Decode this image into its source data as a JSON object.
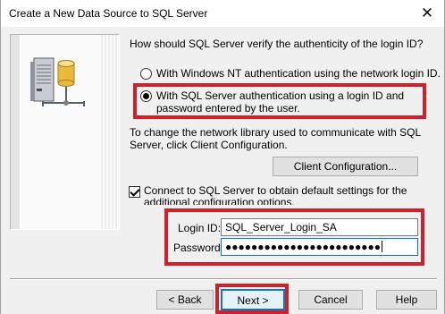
{
  "window": {
    "title": "Create a New Data Source to SQL Server",
    "close_glyph": "✕"
  },
  "icons": {
    "server": "server-database-network-icon",
    "close": "close-icon"
  },
  "auth": {
    "question": "How should SQL Server verify the authenticity of the login ID?",
    "option_nt": "With Windows NT authentication using the network login ID.",
    "option_sql": "With SQL Server authentication using a login ID and password entered by the user.",
    "selected": "sql"
  },
  "network": {
    "text": "To change the network library used to communicate with SQL Server, click Client Configuration.",
    "client_config_button": "Client Configuration..."
  },
  "connect": {
    "checkbox_label": "Connect to SQL Server to obtain default settings for the additional configuration options.",
    "checked": true
  },
  "credentials": {
    "login_label": "Login ID:",
    "login_value": "SQL_Server_Login_SA",
    "password_label": "Password:",
    "password_value": "●●●●●●●●●●●●●●●●●●●●●●●●"
  },
  "buttons": {
    "back": "< Back",
    "next": "Next >",
    "cancel": "Cancel",
    "help": "Help"
  },
  "colors": {
    "highlight": "#d0202a",
    "focus": "#0078d7"
  }
}
